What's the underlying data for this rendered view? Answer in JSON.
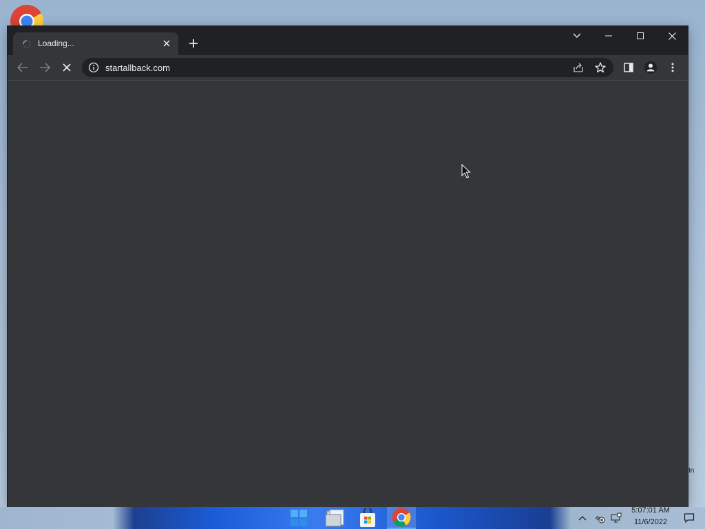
{
  "desktop": {
    "icon": "chrome-icon"
  },
  "browser": {
    "tab": {
      "title": "Loading...",
      "spinner_icon": "loading-spinner-icon",
      "close_icon": "close-icon"
    },
    "new_tab_icon": "plus-icon",
    "window_controls": [
      "tab-search-chevron-icon",
      "minimize-icon",
      "maximize-icon",
      "close-icon"
    ],
    "toolbar": {
      "back_icon": "back-arrow-icon",
      "forward_icon": "forward-arrow-icon",
      "stop_icon": "stop-x-icon",
      "url": "startallback.com",
      "site_info_icon": "info-icon",
      "share_icon": "share-icon",
      "bookmark_icon": "star-icon",
      "side_panel_icon": "side-panel-icon",
      "profile_icon": "profile-icon",
      "menu_icon": "kebab-menu-icon"
    },
    "page": {
      "state": "blank-loading"
    }
  },
  "taskbar": {
    "apps": [
      {
        "name": "Start",
        "icon": "windows-start-icon"
      },
      {
        "name": "File Explorer",
        "icon": "file-explorer-icon"
      },
      {
        "name": "Microsoft Store",
        "icon": "store-icon"
      },
      {
        "name": "Google Chrome",
        "icon": "chrome-icon",
        "active": true
      }
    ],
    "tray": {
      "icons": [
        "chevron-up-icon",
        "network-disconnected-icon",
        "display-icon"
      ],
      "time": "5:07:01 AM",
      "date": "11/6/2022",
      "notification_icon": "notification-icon"
    }
  },
  "stray_text": "In",
  "colors": {
    "chrome_dark": "#202124",
    "toolbar": "#35363a",
    "text": "#e8eaed"
  }
}
